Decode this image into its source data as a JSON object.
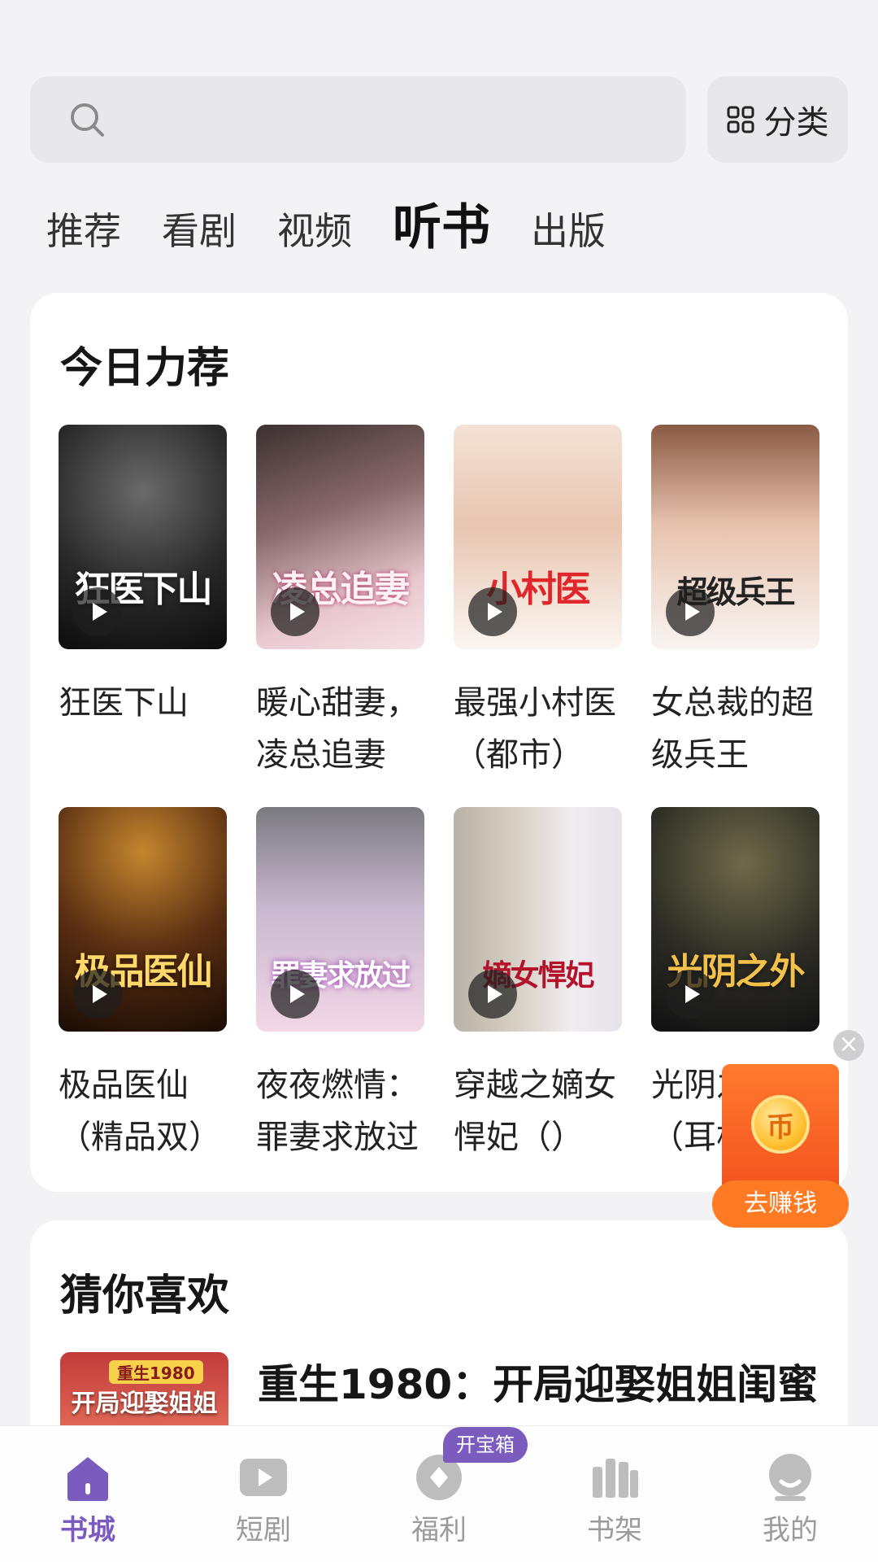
{
  "search": {
    "placeholder": ""
  },
  "category_button": {
    "label": "分类"
  },
  "tabs": [
    {
      "label": "推荐",
      "active": false
    },
    {
      "label": "看剧",
      "active": false
    },
    {
      "label": "视频",
      "active": false
    },
    {
      "label": "听书",
      "active": true
    },
    {
      "label": "出版",
      "active": false
    }
  ],
  "today_rec": {
    "title": "今日力荐",
    "books": [
      {
        "title": "狂医下山",
        "cover_text": "狂医下山"
      },
      {
        "title": "暖心甜妻，凌总追妻",
        "cover_text": "凌总追妻"
      },
      {
        "title": "最强小村医（都市）",
        "cover_text": "小村医"
      },
      {
        "title": "女总裁的超级兵王",
        "cover_text": "超级兵王"
      },
      {
        "title": "极品医仙（精品双）",
        "cover_text": "极品医仙"
      },
      {
        "title": "夜夜燃情：罪妻求放过",
        "cover_text": "罪妻求放过"
      },
      {
        "title": "穿越之嫡女悍妃（）",
        "cover_text": "嫡女悍妃"
      },
      {
        "title": "光阴之外（耳根）",
        "cover_text": "光阴之外"
      }
    ]
  },
  "guess_like": {
    "title": "猜你喜欢",
    "item": {
      "title": "重生1980：开局迎娶姐姐闺蜜",
      "cover_badge": "重生1980",
      "cover_text": "开局迎娶姐姐闺蜜"
    }
  },
  "floating": {
    "close": "×",
    "coin": "币",
    "earn_label": "去赚钱"
  },
  "bottom_nav": {
    "badge": "开宝箱",
    "items": [
      {
        "label": "书城",
        "icon": "home-icon",
        "active": true
      },
      {
        "label": "短剧",
        "icon": "play-icon",
        "active": false
      },
      {
        "label": "福利",
        "icon": "gift-icon",
        "active": false
      },
      {
        "label": "书架",
        "icon": "bookshelf-icon",
        "active": false
      },
      {
        "label": "我的",
        "icon": "profile-icon",
        "active": false
      }
    ]
  },
  "colors": {
    "accent": "#7b5bbd",
    "earn": "#ff7a22"
  }
}
